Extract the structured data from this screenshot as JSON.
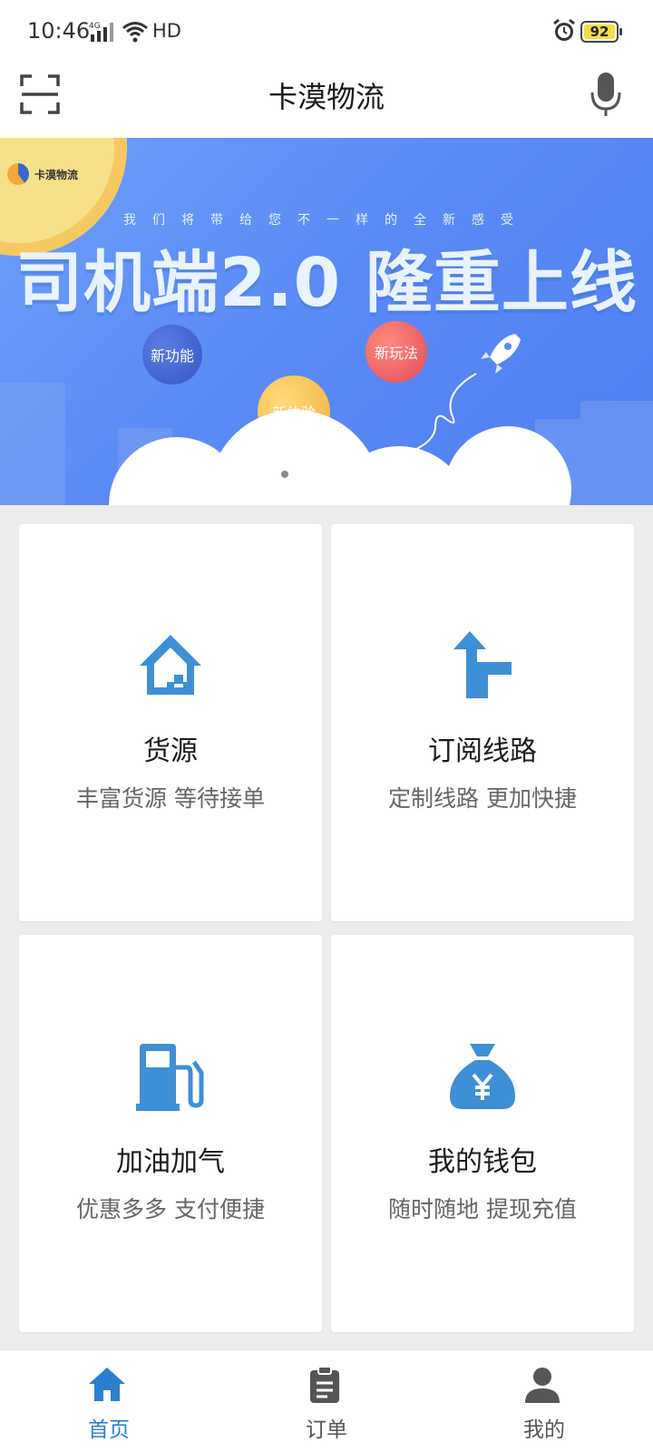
{
  "status_bar": {
    "time": "10:46",
    "network_type": "4G",
    "network_label": "HD",
    "battery": "92",
    "icons": [
      "signal-icon",
      "wifi-icon",
      "alarm-icon",
      "battery-icon"
    ]
  },
  "header": {
    "title": "卡漠物流",
    "scan_icon": "scan-icon",
    "mic_icon": "microphone-icon"
  },
  "banner": {
    "logo_text": "卡漠物流",
    "subtitle": "我们将带给您不一样的全新感受",
    "title": "司机端2.0 隆重上线",
    "bubbles": [
      "新功能",
      "新玩法",
      "新体验"
    ]
  },
  "cards": [
    {
      "title": "货源",
      "subtitle": "丰富货源 等待接单",
      "icon": "house-icon"
    },
    {
      "title": "订阅线路",
      "subtitle": "定制线路 更加快捷",
      "icon": "route-arrow-icon"
    },
    {
      "title": "加油加气",
      "subtitle": "优惠多多 支付便捷",
      "icon": "fuel-pump-icon"
    },
    {
      "title": "我的钱包",
      "subtitle": "随时随地 提现充值",
      "icon": "money-bag-icon"
    }
  ],
  "bottom_nav": {
    "items": [
      {
        "label": "首页",
        "icon": "home-icon",
        "active": true
      },
      {
        "label": "订单",
        "icon": "clipboard-icon",
        "active": false
      },
      {
        "label": "我的",
        "icon": "user-icon",
        "active": false
      }
    ]
  },
  "colors": {
    "accent": "#2a7fd0",
    "card_icon": "#3d8fd6",
    "banner_bg": "#5b8bf5",
    "page_bg": "#ececec"
  }
}
